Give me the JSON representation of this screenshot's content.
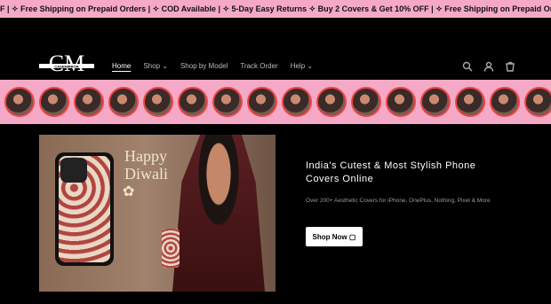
{
  "announcement": {
    "text": "F | ✧ Free Shipping on Prepaid Orders | ✧ COD Available | ✧ 5-Day Easy Returns     ✧ Buy 2 Covers & Get 10% OFF | ✧ Free Shipping on Prepaid Orders | ✧ COD Available | ✧"
  },
  "brand": {
    "logo_text": "CM",
    "logo_sub": "CASEMIRROR"
  },
  "nav": {
    "home": "Home",
    "shop": "Shop ⌄",
    "shop_by_model": "Shop by Model",
    "track_order": "Track Order",
    "help": "Help ⌄"
  },
  "colors": {
    "accent_pink": "#f5a9c6",
    "story_ring": "#e44444"
  },
  "stories": {
    "count_label": ""
  },
  "hero_image": {
    "greeting": "Happy\nDiwali"
  },
  "hero": {
    "title": "India's Cutest & Most Stylish Phone Covers Online",
    "subtitle": "Over 200+ Aesthetic Covers for iPhone, OnePlus, Nothing, Pixel & More",
    "cta": "Shop Now ▢"
  }
}
